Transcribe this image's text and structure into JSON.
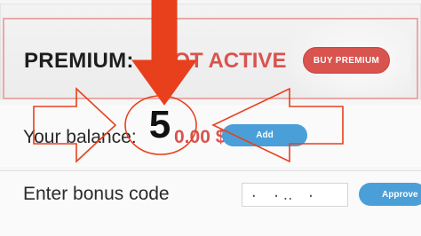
{
  "premium": {
    "label": "PREMIUM:",
    "status": "NOT ACTIVE",
    "buy_button": "BUY PREMIUM"
  },
  "balance": {
    "label": "Your balance:",
    "value": "0.00 $",
    "add_button": "Add"
  },
  "bonus": {
    "label": "Enter bonus code",
    "input_value": "· ·‥ ·",
    "approve_button": "Approve"
  },
  "annotation": {
    "step_number": "5",
    "color": "#e8401c"
  },
  "colors": {
    "status_red": "#d9534f",
    "button_blue": "#4a9fd8"
  }
}
